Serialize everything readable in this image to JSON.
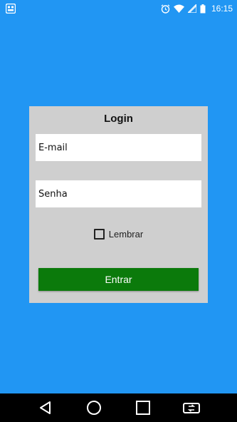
{
  "status_bar": {
    "time": "16:15",
    "icons": [
      "app-notification-icon",
      "alarm-icon",
      "wifi-icon",
      "signal-icon",
      "battery-icon"
    ]
  },
  "login": {
    "title": "Login",
    "email_placeholder": "E-mail",
    "password_placeholder": "Senha",
    "remember_label": "Lembrar",
    "remember_checked": false,
    "submit_label": "Entrar"
  },
  "nav_bar": {
    "icons": [
      "back-icon",
      "home-icon",
      "recents-icon",
      "screen-rotate-icon"
    ]
  },
  "colors": {
    "background": "#2196F3",
    "card": "#CFCFCF",
    "button": "#0B7A0B",
    "nav_bar": "#000000"
  }
}
